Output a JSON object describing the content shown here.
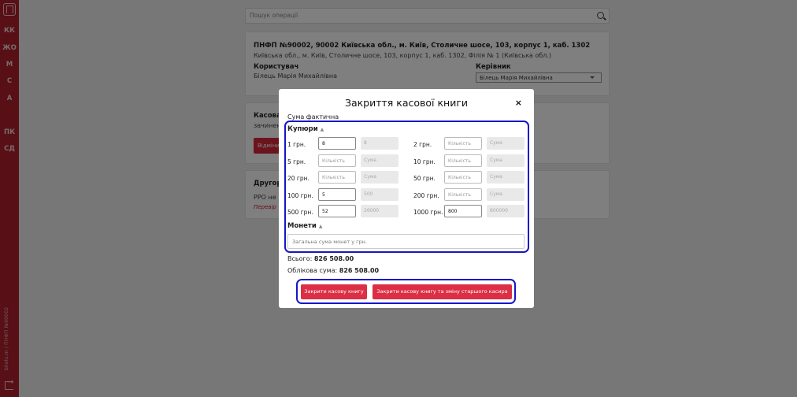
{
  "sidebar": {
    "items": [
      "КК",
      "ЖО",
      "М",
      "С",
      "А",
      "ПК",
      "СД"
    ],
    "footer": "bilets.m / ПНФП №90002"
  },
  "search": {
    "placeholder": "Пошук операції"
  },
  "card1": {
    "title": "ПНФП №90002, 90002 Київська обл., м. Київ, Столичне шосе, 103, корпус 1, каб. 1302",
    "address": "Київська обл., м. Київ, Столичне шосе, 103, корпус 1, каб. 1302, Філія № 1 (Київська обл.)",
    "user_label": "Користувач",
    "user_value": "Білець Марія Михайлівна",
    "manager_label": "Керівник",
    "manager_value": "Білець Марія Михайлівна"
  },
  "card2": {
    "title": "Касова к",
    "text": "зачинен",
    "button": "Відміни"
  },
  "card3": {
    "title": "Другорядн",
    "text": "РРО не",
    "link": "Перевір"
  },
  "modal": {
    "title": "Закриття касової книги",
    "close": "×",
    "subtitle": "Сума фактична",
    "bills_header": "Купюри",
    "coins_header": "Монети",
    "qty_placeholder": "Кількість",
    "sum_placeholder": "Сума",
    "bills": [
      {
        "label": "1 грн.",
        "qty": "8",
        "sum": "8"
      },
      {
        "label": "2 грн.",
        "qty": "",
        "sum": ""
      },
      {
        "label": "5 грн.",
        "qty": "",
        "sum": ""
      },
      {
        "label": "10 грн.",
        "qty": "",
        "sum": ""
      },
      {
        "label": "20 грн.",
        "qty": "",
        "sum": ""
      },
      {
        "label": "50 грн.",
        "qty": "",
        "sum": ""
      },
      {
        "label": "100 грн.",
        "qty": "5",
        "sum": "500"
      },
      {
        "label": "200 грн.",
        "qty": "",
        "sum": ""
      },
      {
        "label": "500 грн.",
        "qty": "52",
        "sum": "26000"
      },
      {
        "label": "1000 грн.",
        "qty": "800",
        "sum": "800000"
      }
    ],
    "coins_placeholder": "Загальна сума монет у грн.",
    "total_label": "Всього:",
    "total_value": "826 508.00",
    "account_label": "Облікова сума:",
    "account_value": "826 508.00",
    "btn_close": "Закрити касову книгу",
    "btn_close_change": "Закрити касову книгу та зміну старшого касира"
  }
}
